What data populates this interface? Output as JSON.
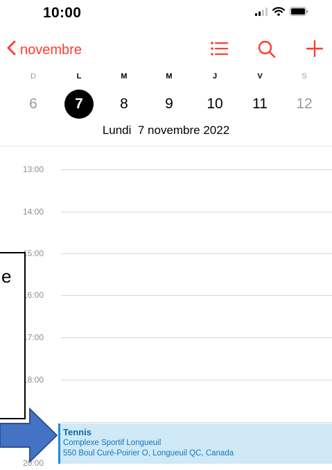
{
  "status_bar": {
    "time": "10:00"
  },
  "toolbar": {
    "back_label": "novembre",
    "list_icon": "list-icon",
    "search_icon": "search-icon",
    "add_icon": "plus-icon",
    "accent_color": "#ff3b30"
  },
  "week": {
    "weekdays": [
      "D",
      "L",
      "M",
      "M",
      "J",
      "V",
      "S"
    ],
    "days": [
      "6",
      "7",
      "8",
      "9",
      "10",
      "11",
      "12"
    ],
    "selected_index": 1
  },
  "date_title": "Lundi  7 novembre 2022",
  "timeline": {
    "hours": [
      "13:00",
      "14:00",
      "15:00",
      "16:00",
      "17:00",
      "18:00",
      "20:00"
    ]
  },
  "event": {
    "title": "Tennis",
    "location_line1": "Complexe Sportif Longueuil",
    "location_line2": "550 Boul Curé-Poirier O, Longueuil QC, Canada",
    "color": "#1a8fd6"
  },
  "annotation": {
    "text": "e",
    "arrow_color": "#4472c4"
  }
}
